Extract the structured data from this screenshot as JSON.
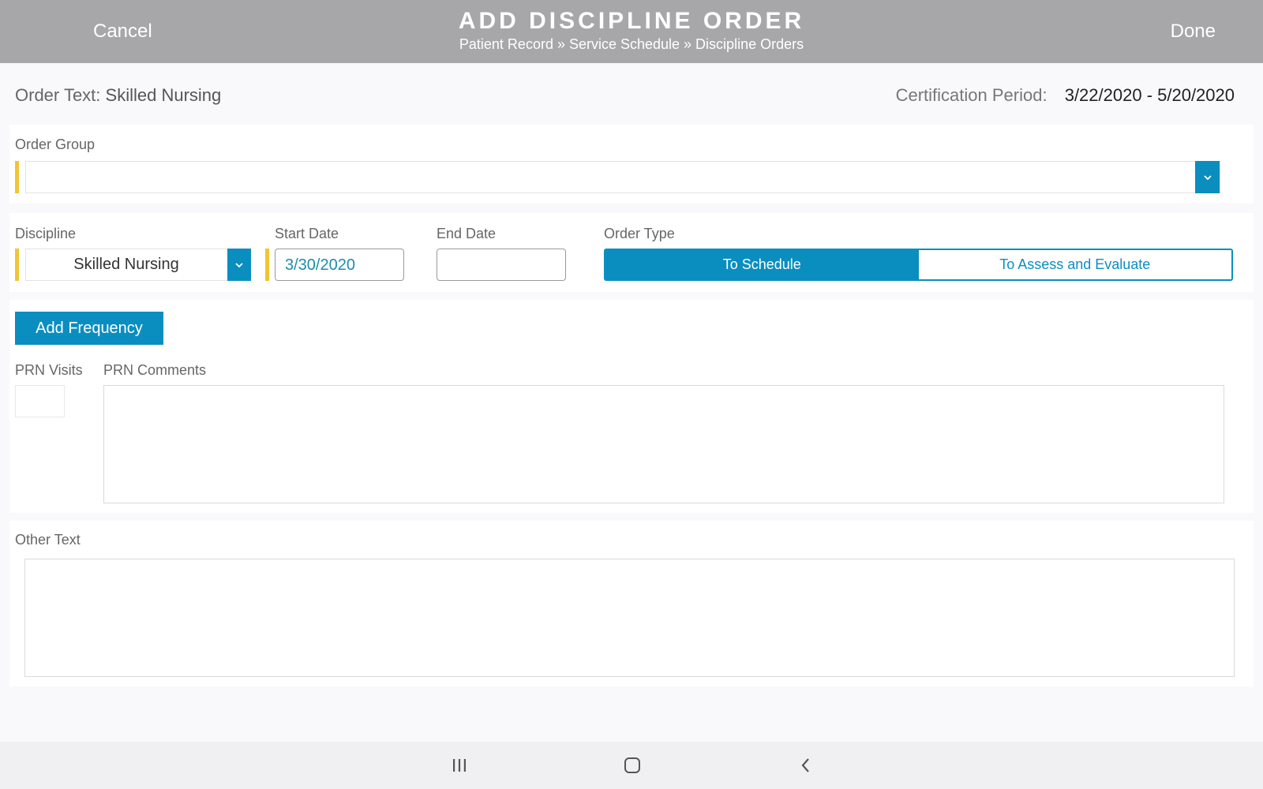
{
  "header": {
    "cancel_label": "Cancel",
    "done_label": "Done",
    "title": "ADD DISCIPLINE ORDER",
    "breadcrumb": "Patient Record » Service Schedule » Discipline Orders"
  },
  "summary": {
    "order_text_label": "Order Text:",
    "order_text_value": "Skilled Nursing",
    "cert_period_label": "Certification Period:",
    "cert_period_value": "3/22/2020 - 5/20/2020"
  },
  "form": {
    "order_group": {
      "label": "Order Group",
      "value": ""
    },
    "discipline": {
      "label": "Discipline",
      "value": "Skilled Nursing"
    },
    "start_date": {
      "label": "Start Date",
      "value": "3/30/2020"
    },
    "end_date": {
      "label": "End Date",
      "value": ""
    },
    "order_type": {
      "label": "Order Type",
      "options": [
        "To Schedule",
        "To Assess and Evaluate"
      ],
      "selected": "To Schedule"
    },
    "add_frequency_label": "Add Frequency",
    "prn_visits": {
      "label": "PRN Visits",
      "value": ""
    },
    "prn_comments": {
      "label": "PRN Comments",
      "value": ""
    },
    "other_text": {
      "label": "Other Text",
      "value": ""
    }
  },
  "colors": {
    "header_bg": "#a7a7aa",
    "accent": "#0a8ec0",
    "required_marker": "#f2c433"
  },
  "navbar": {
    "icons": [
      "recent-apps-icon",
      "home-icon",
      "back-icon"
    ]
  }
}
